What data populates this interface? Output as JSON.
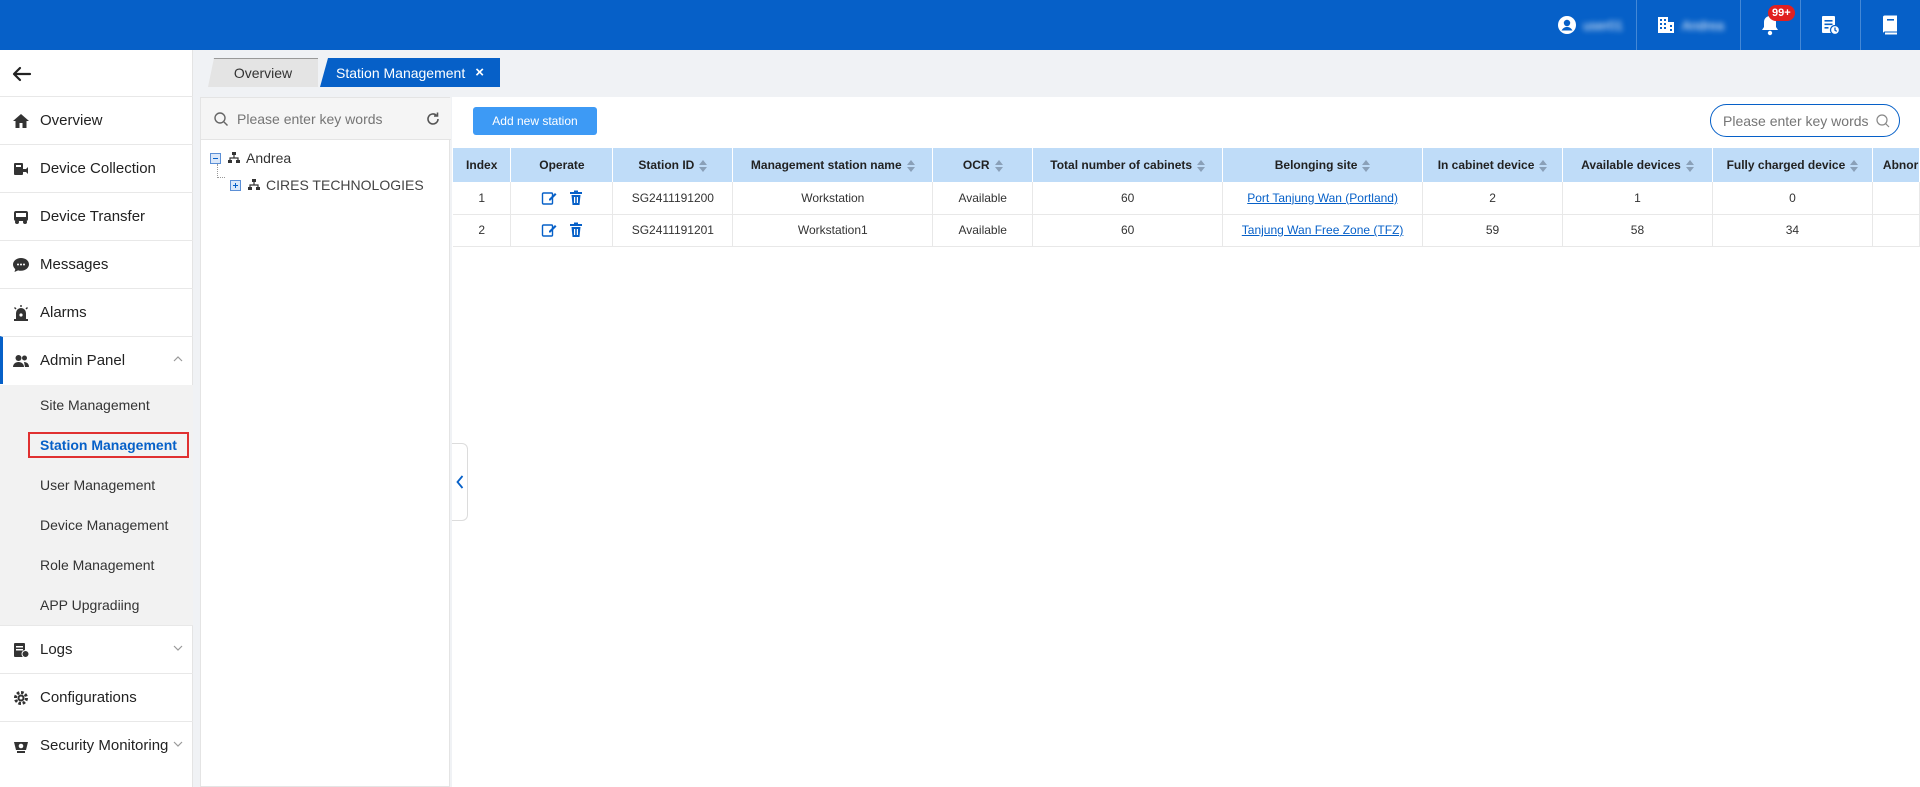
{
  "topbar": {
    "user_name": "user01",
    "org_name": "Andrea",
    "notification_count": "99+"
  },
  "sidebar": {
    "items": [
      {
        "label": "Overview"
      },
      {
        "label": "Device Collection"
      },
      {
        "label": "Device Transfer"
      },
      {
        "label": "Messages"
      },
      {
        "label": "Alarms"
      },
      {
        "label": "Admin Panel"
      },
      {
        "label": "Logs"
      },
      {
        "label": "Configurations"
      },
      {
        "label": "Security Monitoring"
      }
    ],
    "admin_submenu": [
      {
        "label": "Site Management"
      },
      {
        "label": "Station Management"
      },
      {
        "label": "User Management"
      },
      {
        "label": "Device Management"
      },
      {
        "label": "Role Management"
      },
      {
        "label": "APP Upgradiing"
      }
    ]
  },
  "tabs": {
    "overview": "Overview",
    "station": "Station Management",
    "close_glyph": "×"
  },
  "tree": {
    "search_placeholder": "Please enter key words",
    "root": "Andrea",
    "child": "CIRES TECHNOLOGIES"
  },
  "toolbar": {
    "add_label": "Add new station",
    "search_placeholder": "Please enter key words"
  },
  "table": {
    "headers": [
      "Index",
      "Operate",
      "Station ID",
      "Management station name",
      "OCR",
      "Total number of cabinets",
      "Belonging site",
      "In cabinet device",
      "Available devices",
      "Fully charged device",
      "Abnor"
    ],
    "rows": [
      {
        "index": "1",
        "station_id": "SG2411191200",
        "name": "Workstation",
        "ocr": "Available",
        "cabinets": "60",
        "site": "Port Tanjung Wan (Portland)",
        "in_cabinet": "2",
        "available": "1",
        "charged": "0"
      },
      {
        "index": "2",
        "station_id": "SG2411191201",
        "name": "Workstation1",
        "ocr": "Available",
        "cabinets": "60",
        "site": "Tanjung Wan Free Zone (TFZ)",
        "in_cabinet": "59",
        "available": "58",
        "charged": "34"
      }
    ]
  }
}
